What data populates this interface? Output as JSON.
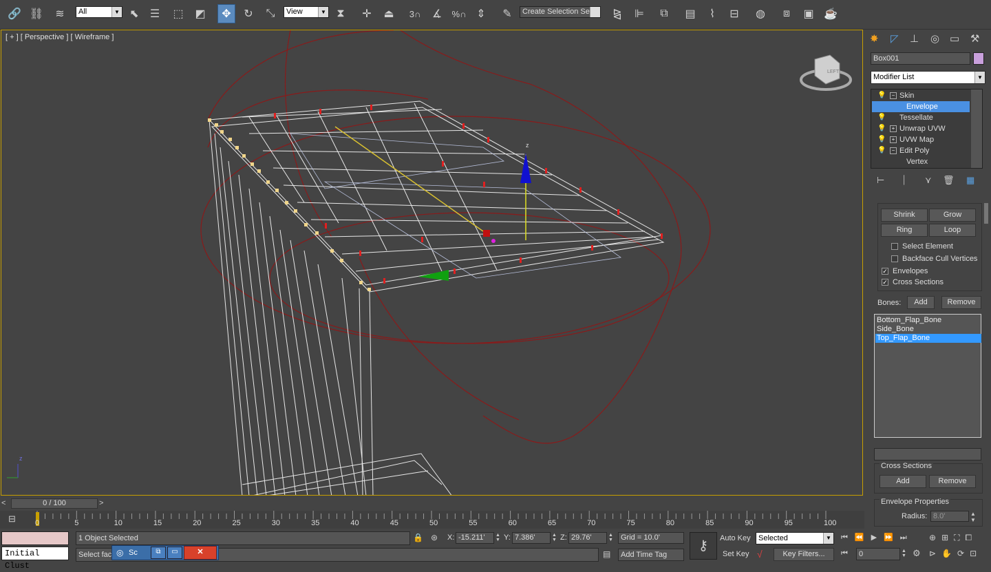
{
  "toolbar": {
    "filter_select": "All",
    "ref_coord_select": "View",
    "snap_label": "3",
    "selection_set_placeholder": "Create Selection Se"
  },
  "viewport": {
    "label": "[ + ] [ Perspective ] [ Wireframe ]",
    "axis_label_z": "z",
    "gizmo_z_label": "z",
    "viewcube_label": "LEFT"
  },
  "panel": {
    "object_name": "Box001",
    "object_color": "#c9a0dc",
    "modifier_list": "Modifier List",
    "stack": [
      {
        "label": "Skin",
        "expand": "−",
        "selected": false
      },
      {
        "label": "Envelope",
        "expand": "",
        "selected": true
      },
      {
        "label": "Tessellate",
        "expand": "",
        "selected": false
      },
      {
        "label": "Unwrap UVW",
        "expand": "+",
        "selected": false
      },
      {
        "label": "UVW Map",
        "expand": "+",
        "selected": false
      },
      {
        "label": "Edit Poly",
        "expand": "−",
        "selected": false
      },
      {
        "label": "Vertex",
        "expand": "",
        "selected": false
      }
    ],
    "shrink": "Shrink",
    "grow": "Grow",
    "ring": "Ring",
    "loop": "Loop",
    "select_element": "Select Element",
    "backface_cull": "Backface Cull Vertices",
    "envelopes": "Envelopes",
    "cross_sections": "Cross Sections",
    "bones_label": "Bones:",
    "bones_add": "Add",
    "bones_remove": "Remove",
    "bones": [
      "Bottom_Flap_Bone",
      "Side_Bone",
      "Top_Flap_Bone"
    ],
    "selected_bone": "Top_Flap_Bone",
    "cross_sections_group": "Cross Sections",
    "cs_add": "Add",
    "cs_remove": "Remove",
    "envelope_props": "Envelope Properties",
    "radius_label": "Radius:",
    "radius_value": "8.0'"
  },
  "timeline": {
    "slider_text": "0 / 100",
    "ticks": [
      "0",
      "5",
      "10",
      "15",
      "20",
      "25",
      "30",
      "35",
      "40",
      "45",
      "50",
      "55",
      "60",
      "65",
      "70",
      "75",
      "80",
      "85",
      "90",
      "95",
      "100"
    ]
  },
  "status": {
    "maxscript_value": "Initial Clust",
    "objects_selected": "1 Object Selected",
    "prompt": "Select fac",
    "taskbar_label": "Sc",
    "x_label": "X:",
    "x_value": "-15.211'",
    "y_label": "Y:",
    "y_value": "7.386'",
    "z_label": "Z:",
    "z_value": "29.76'",
    "grid": "Grid = 10.0'",
    "add_time_tag": "Add Time Tag",
    "auto_key": "Auto Key",
    "set_key": "Set Key",
    "selected_dropdown": "Selected",
    "key_filters": "Key Filters...",
    "frame_value": "0"
  }
}
